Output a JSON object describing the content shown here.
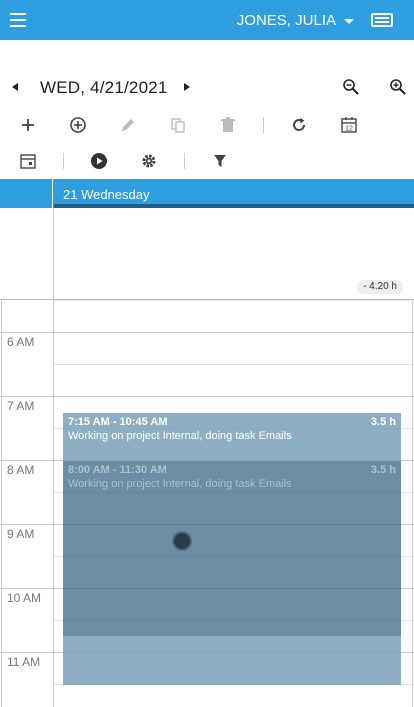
{
  "header": {
    "user_name": "JONES, JULIA",
    "colors": {
      "bar": "#2f9ee0"
    },
    "icons": {
      "menu": "hamburger-icon",
      "dropdown": "caret-down-icon",
      "keyboard": "keyboard-icon"
    }
  },
  "date_nav": {
    "date_label": "WED, 4/21/2021",
    "icons": {
      "prev": "chevron-left-icon",
      "next": "chevron-right-icon",
      "zoom_out": "zoom-out-icon",
      "zoom_in": "zoom-in-icon"
    }
  },
  "toolbar": {
    "row1": [
      "add-icon",
      "add-circle-icon",
      "edit-icon",
      "copy-icon",
      "delete-icon",
      "refresh-icon",
      "calendar-12-icon"
    ],
    "calendar_icon_text": "12",
    "row2": [
      "calendar-icon",
      "play-icon",
      "settings-icon",
      "filter-icon"
    ]
  },
  "day_header": {
    "label": "21 Wednesday",
    "colors": {
      "underline": "#1b5f8a"
    }
  },
  "all_day": {
    "hours_badge": "- 4.20 h"
  },
  "hours": [
    "6 AM",
    "7 AM",
    "8 AM",
    "9 AM",
    "10 AM",
    "11 AM"
  ],
  "events": [
    {
      "time": "7:15 AM - 10:45 AM",
      "duration": "3.5 h",
      "description": "Working on project Internal, doing task Emails"
    },
    {
      "time": "8:00 AM - 11:30 AM",
      "duration": "3.5 h",
      "description": "Working on project Internal, doing task Emails"
    }
  ]
}
